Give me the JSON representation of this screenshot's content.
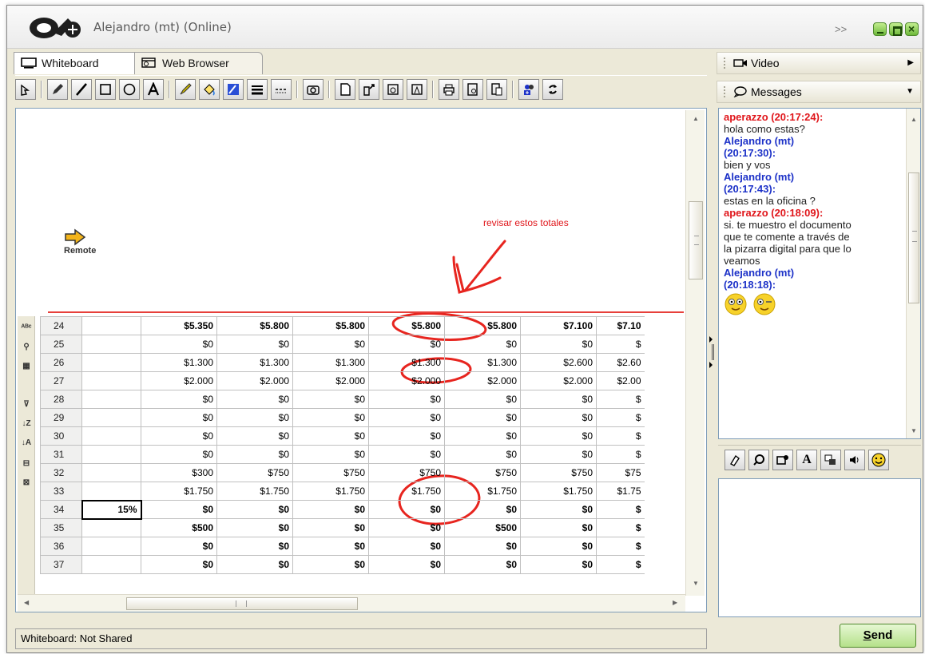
{
  "window": {
    "title": "Alejandro (mt) (Online)",
    "more_label": ">>"
  },
  "tabs": [
    {
      "label": "Whiteboard",
      "active": true
    },
    {
      "label": "Web Browser",
      "active": false
    }
  ],
  "toolbar": {
    "icons": [
      "pointer-icon",
      "pencil-icon",
      "line-icon",
      "rectangle-icon",
      "ellipse-icon",
      "text-icon",
      "marker-icon",
      "fill-icon",
      "color-icon",
      "line-width-icon",
      "line-style-icon",
      "camera-icon",
      "new-page-icon",
      "open-icon",
      "save-icon",
      "import-icon",
      "print-icon",
      "preview-icon",
      "page-icon",
      "share-icon",
      "refresh-icon"
    ]
  },
  "whiteboard": {
    "remote_label": "Remote",
    "annotation": "revisar estos totales",
    "rows": [
      {
        "n": "24",
        "b": "",
        "c": [
          "$5.350",
          "$5.800",
          "$5.800",
          "$5.800",
          "$5.800",
          "$7.100",
          "$7.10"
        ],
        "bold": true
      },
      {
        "n": "25",
        "b": "",
        "c": [
          "$0",
          "$0",
          "$0",
          "$0",
          "$0",
          "$0",
          "$"
        ]
      },
      {
        "n": "26",
        "b": "",
        "c": [
          "$1.300",
          "$1.300",
          "$1.300",
          "$1.300",
          "$1.300",
          "$2.600",
          "$2.60"
        ]
      },
      {
        "n": "27",
        "b": "",
        "c": [
          "$2.000",
          "$2.000",
          "$2.000",
          "$2.000",
          "$2.000",
          "$2.000",
          "$2.00"
        ]
      },
      {
        "n": "28",
        "b": "",
        "c": [
          "$0",
          "$0",
          "$0",
          "$0",
          "$0",
          "$0",
          "$"
        ]
      },
      {
        "n": "29",
        "b": "",
        "c": [
          "$0",
          "$0",
          "$0",
          "$0",
          "$0",
          "$0",
          "$"
        ]
      },
      {
        "n": "30",
        "b": "",
        "c": [
          "$0",
          "$0",
          "$0",
          "$0",
          "$0",
          "$0",
          "$"
        ]
      },
      {
        "n": "31",
        "b": "",
        "c": [
          "$0",
          "$0",
          "$0",
          "$0",
          "$0",
          "$0",
          "$"
        ]
      },
      {
        "n": "32",
        "b": "",
        "c": [
          "$300",
          "$750",
          "$750",
          "$750",
          "$750",
          "$750",
          "$75"
        ]
      },
      {
        "n": "33",
        "b": "",
        "c": [
          "$1.750",
          "$1.750",
          "$1.750",
          "$1.750",
          "$1.750",
          "$1.750",
          "$1.75"
        ]
      },
      {
        "n": "34",
        "b": "15%",
        "c": [
          "$0",
          "$0",
          "$0",
          "$0",
          "$0",
          "$0",
          "$"
        ],
        "bold": true
      },
      {
        "n": "35",
        "b": "",
        "c": [
          "$500",
          "$0",
          "$0",
          "$0",
          "$500",
          "$0",
          "$"
        ],
        "bold": true
      },
      {
        "n": "36",
        "b": "",
        "c": [
          "$0",
          "$0",
          "$0",
          "$0",
          "$0",
          "$0",
          "$"
        ],
        "bold": true
      },
      {
        "n": "37",
        "b": "",
        "c": [
          "$0",
          "$0",
          "$0",
          "$0",
          "$0",
          "$0",
          "$"
        ],
        "bold": true
      }
    ]
  },
  "status_bar": {
    "text": "Whiteboard: Not Shared"
  },
  "right_pane": {
    "video_label": "Video",
    "messages_label": "Messages",
    "messages": [
      {
        "type": "sender",
        "color": "red",
        "text": "aperazzo (20:17:24):"
      },
      {
        "type": "text",
        "text": "hola como estas?"
      },
      {
        "type": "sender",
        "color": "blue",
        "text": "Alejandro (mt)"
      },
      {
        "type": "sender",
        "color": "blue",
        "text": "(20:17:30):"
      },
      {
        "type": "text",
        "text": "bien y vos"
      },
      {
        "type": "sender",
        "color": "blue",
        "text": "Alejandro (mt)"
      },
      {
        "type": "sender",
        "color": "blue",
        "text": "(20:17:43):"
      },
      {
        "type": "text",
        "text": "estas en la oficina ?"
      },
      {
        "type": "sender",
        "color": "red",
        "text": "aperazzo (20:18:09):"
      },
      {
        "type": "text",
        "text": "si. te muestro el documento"
      },
      {
        "type": "text",
        "text": "que te comente a través de"
      },
      {
        "type": "text",
        "text": "la pizarra digital para que lo"
      },
      {
        "type": "text",
        "text": "veamos"
      },
      {
        "type": "sender",
        "color": "blue",
        "text": "Alejandro (mt)"
      },
      {
        "type": "sender",
        "color": "blue",
        "text": "(20:18:18):"
      }
    ],
    "format_icons": [
      "eraser-icon",
      "font-style-icon",
      "emoticon-menu-icon",
      "font-icon",
      "translate-icon",
      "sound-icon",
      "smiley-icon"
    ],
    "font_button_label": "A",
    "send_label": "Send"
  },
  "colors": {
    "sender_red": "#e0151a",
    "sender_blue": "#1d32c8",
    "annotation_red": "#e0151a",
    "accent_green": "#6db83a"
  }
}
